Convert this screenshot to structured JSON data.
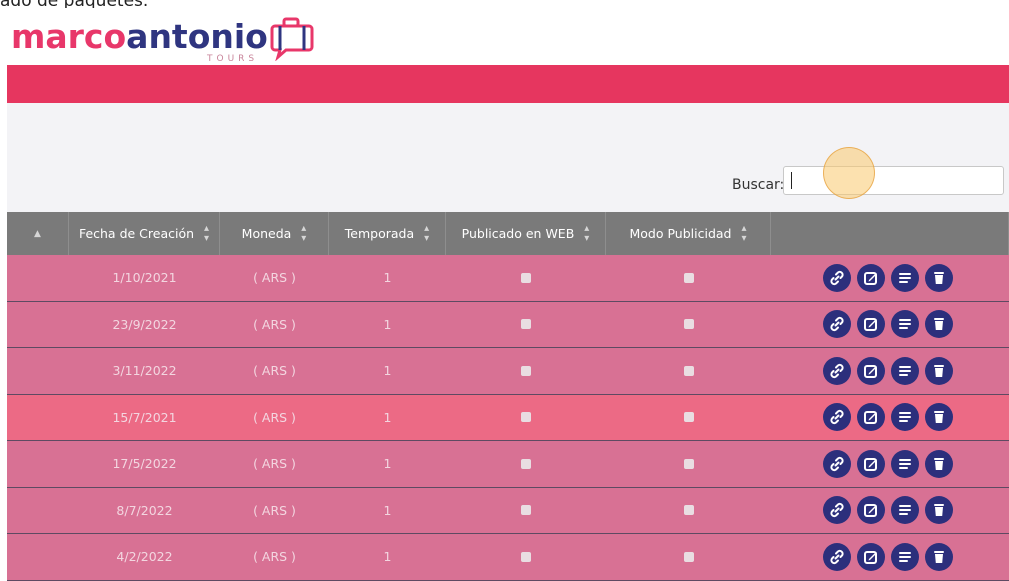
{
  "page_title_cut": "ado de paquetes.",
  "brand": {
    "name_part1": "marco",
    "name_part2": "antonio",
    "tagline": "TOURS",
    "colors": {
      "pink": "#e8376a",
      "navy": "#2f3580"
    }
  },
  "search": {
    "label": "Buscar:",
    "value": ""
  },
  "table": {
    "headers": [
      "",
      "Fecha de Creación",
      "Moneda",
      "Temporada",
      "Publicado en WEB",
      "Modo Publicidad",
      ""
    ],
    "action_icons": [
      "link-icon",
      "edit-icon",
      "details-icon",
      "trash-icon"
    ],
    "rows": [
      {
        "fecha": "1/10/2021",
        "moneda": "( ARS )",
        "temporada": "1",
        "publicado_web": false,
        "modo_publicidad": false
      },
      {
        "fecha": "23/9/2022",
        "moneda": "( ARS )",
        "temporada": "1",
        "publicado_web": false,
        "modo_publicidad": false
      },
      {
        "fecha": "3/11/2022",
        "moneda": "( ARS )",
        "temporada": "1",
        "publicado_web": false,
        "modo_publicidad": false
      },
      {
        "fecha": "15/7/2021",
        "moneda": "( ARS )",
        "temporada": "1",
        "publicado_web": false,
        "modo_publicidad": false
      },
      {
        "fecha": "17/5/2022",
        "moneda": "( ARS )",
        "temporada": "1",
        "publicado_web": false,
        "modo_publicidad": false
      },
      {
        "fecha": "8/7/2022",
        "moneda": "( ARS )",
        "temporada": "1",
        "publicado_web": false,
        "modo_publicidad": false
      },
      {
        "fecha": "4/2/2022",
        "moneda": "( ARS )",
        "temporada": "1",
        "publicado_web": false,
        "modo_publicidad": false
      }
    ],
    "highlighted_row": 3
  }
}
